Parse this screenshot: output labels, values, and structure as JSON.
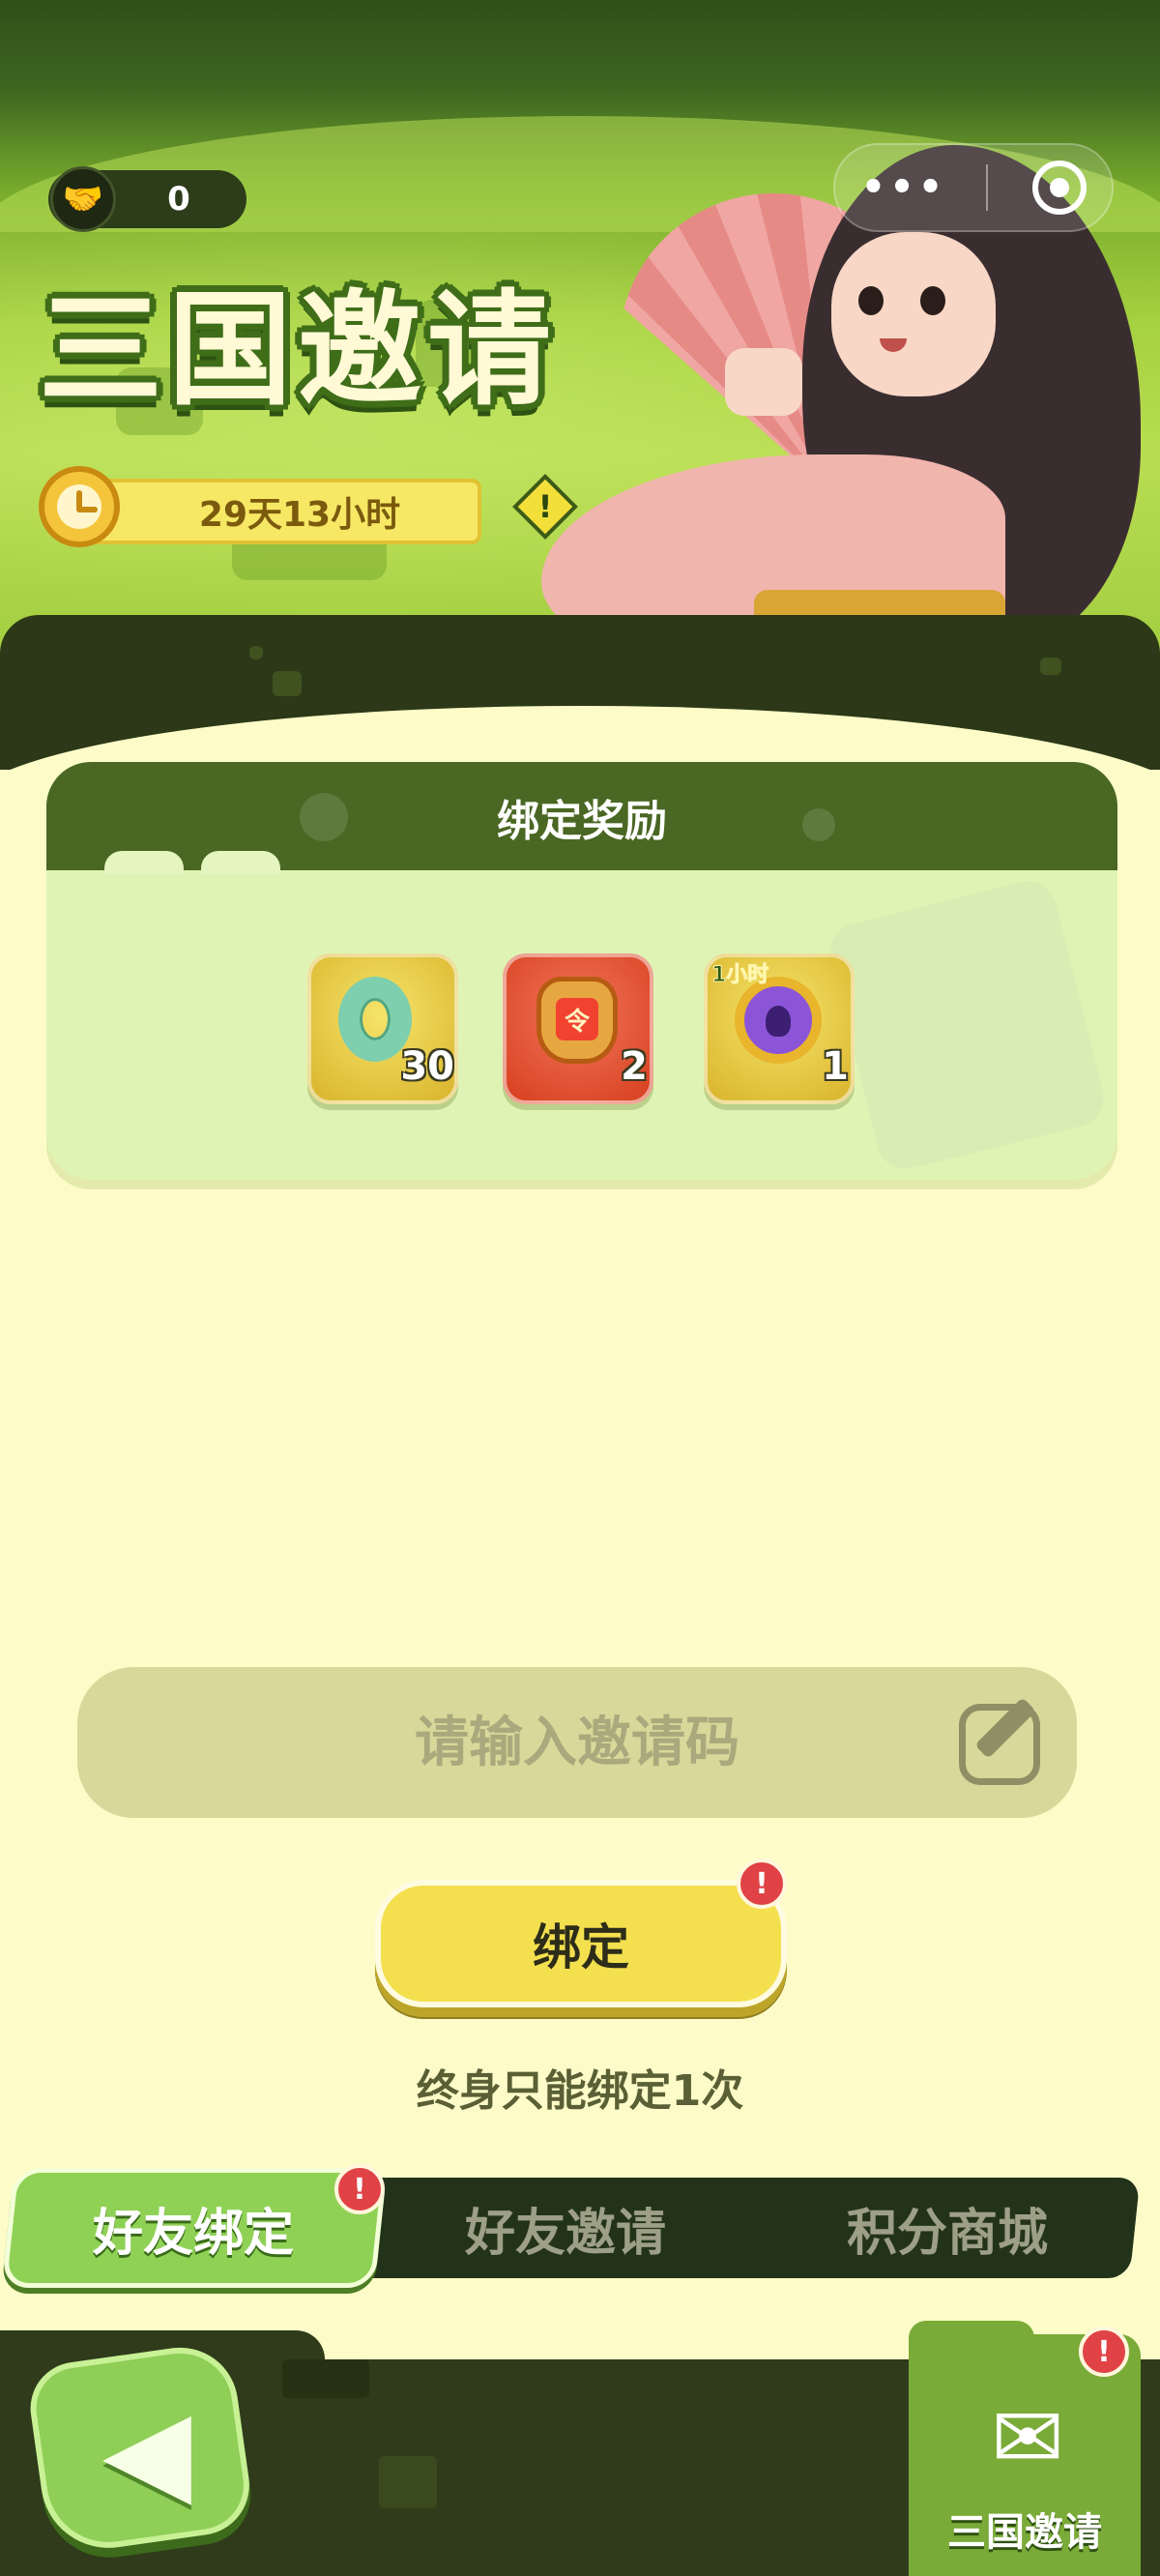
{
  "header": {
    "title": "三国邀请",
    "coin_count": "0",
    "countdown": "29天13小时"
  },
  "reward_card": {
    "title": "绑定奖励",
    "rewards": [
      {
        "icon": "jade-ring-icon",
        "quantity": "30"
      },
      {
        "icon": "seal-token-icon",
        "quantity": "2"
      },
      {
        "icon": "stopwatch-icon",
        "tag": "1小时",
        "quantity": "1"
      }
    ]
  },
  "invite": {
    "placeholder": "请输入邀请码",
    "bind_label": "绑定",
    "hint": "终身只能绑定1次"
  },
  "badges": {
    "alert": "!"
  },
  "tabs": [
    {
      "label": "好友绑定",
      "active": true
    },
    {
      "label": "好友邀请",
      "active": false
    },
    {
      "label": "积分商城",
      "active": false
    }
  ],
  "side_entry": {
    "label": "三国邀请"
  },
  "colors": {
    "header_green": "#78ab2c",
    "dark_green": "#2c3817",
    "cream": "#fdfcc8",
    "button_yellow": "#f4e04e",
    "badge_red": "#e04246",
    "tab_active": "#8fd155"
  }
}
